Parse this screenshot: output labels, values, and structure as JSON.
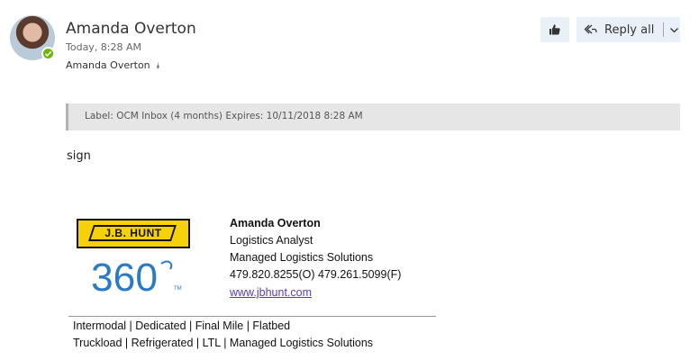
{
  "message": {
    "sender_name": "Amanda Overton",
    "timestamp": "Today, 8:28 AM",
    "recipient": "Amanda Overton",
    "presence_color": "#6bb700"
  },
  "actions": {
    "like_icon": "thumbs-up-icon",
    "reply_all_label": "Reply all",
    "reply_icon": "reply-all-icon"
  },
  "label_banner": {
    "text": "Label: OCM Inbox (4 months) Expires: 10/11/2018 8:28 AM"
  },
  "body": {
    "text": "sign"
  },
  "signature": {
    "logo_text": "J.B. HUNT",
    "logo_360": "360",
    "logo_tm": "TM",
    "name": "Amanda Overton",
    "title": "Logistics Analyst",
    "department": "Managed Logistics Solutions",
    "phone": "479.820.8255(O) 479.261.5099(F)",
    "website": "www.jbhunt.com",
    "services_line1": "Intermodal | Dedicated | Final Mile | Flatbed",
    "services_line2": "Truckload | Refrigerated | LTL | Managed Logistics Solutions",
    "brand_yellow": "#f6d10a",
    "brand_blue": "#2a7bc4"
  }
}
